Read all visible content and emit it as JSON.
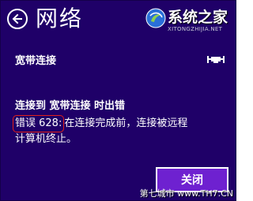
{
  "header": {
    "title": "网络",
    "back_icon": "back-arrow-icon"
  },
  "watermark_top": {
    "name": "系统之家",
    "url": "XITONGZHIJIA.NET"
  },
  "connection": {
    "name": "宽带连接",
    "icon": "ethernet-icon"
  },
  "message": {
    "title": "连接到 宽带连接 时出错",
    "error_code": "错误 628:",
    "error_text_part1": "在连接完成前，连接被远程",
    "error_text_part2": "计算机终止。"
  },
  "buttons": {
    "close_label": "关闭"
  },
  "watermark_bottom": {
    "text": "第七城市 www.TH7.CN"
  },
  "colors": {
    "panel_background": "#1f0068",
    "button_background": "#6e21d0",
    "error_highlight": "#e0201a"
  }
}
